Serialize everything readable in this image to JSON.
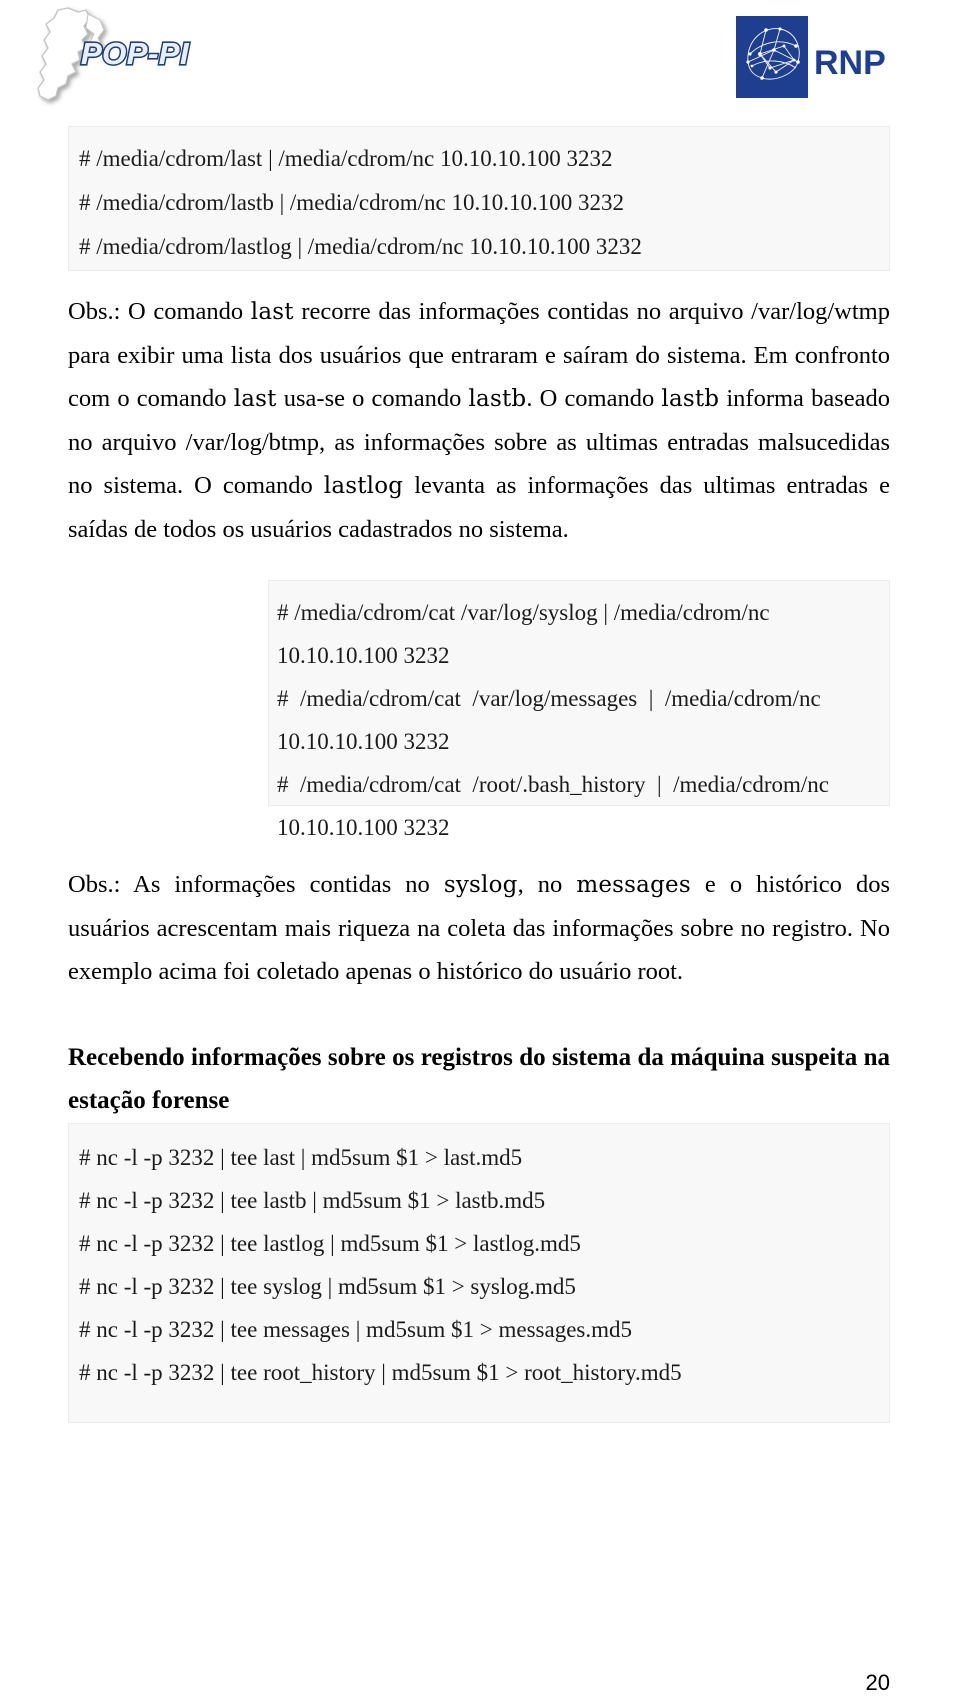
{
  "header": {
    "left_logo": {
      "name": "POP-PI",
      "text": "POP-PI",
      "text_color": "#1f3f7a",
      "map_fill": "#ffffff",
      "map_stroke": "#b9b9b9"
    },
    "right_logo": {
      "name": "RNP",
      "text": "RNP",
      "text_color": "#1c3f94",
      "box_color": "#1e3f8f",
      "network_color": "#ffffff"
    }
  },
  "code_block_1": {
    "lines": [
      "# /media/cdrom/last | /media/cdrom/nc 10.10.10.100 3232",
      "# /media/cdrom/lastb | /media/cdrom/nc 10.10.10.100 3232",
      "# /media/cdrom/lastlog | /media/cdrom/nc 10.10.10.100 3232"
    ]
  },
  "paragraph_1": {
    "prefix": "Obs.:",
    "segments": [
      {
        "t": " O comando ",
        "style": "normal"
      },
      {
        "t": "last",
        "style": "mono"
      },
      {
        "t": " recorre das informações contidas no arquivo /var/log/wtmp para exibir uma lista dos usuários que entraram e saíram do sistema. Em confronto com o comando ",
        "style": "normal"
      },
      {
        "t": "last",
        "style": "mono"
      },
      {
        "t": " usa-se o comando ",
        "style": "normal"
      },
      {
        "t": "lastb",
        "style": "mono"
      },
      {
        "t": ". O comando ",
        "style": "normal"
      },
      {
        "t": "lastb",
        "style": "mono"
      },
      {
        "t": " informa baseado no arquivo /var/log/btmp, as informações sobre as ultimas entradas malsucedidas no sistema. O comando ",
        "style": "normal"
      },
      {
        "t": "lastlog",
        "style": "mono"
      },
      {
        "t": " levanta as informações das ultimas entradas e saídas de todos os usuários cadastrados no sistema.",
        "style": "normal"
      }
    ],
    "full_text": "Obs.: O comando last recorre das informações contidas no arquivo /var/log/wtmp para exibir uma lista dos usuários que entraram e saíram do sistema. Em confronto com o comando last usa-se o comando lastb. O comando lastb informa baseado no arquivo /var/log/btmp, as informações sobre as ultimas entradas malsucedidas no sistema. O comando lastlog levanta as informações das ultimas entradas e saídas de todos os usuários cadastrados no sistema."
  },
  "code_block_2": {
    "lines": [
      "# /media/cdrom/cat /var/log/syslog | /media/cdrom/nc 10.10.10.100 3232",
      "#  /media/cdrom/cat  /var/log/messages  |  /media/cdrom/nc  10.10.10.100 3232",
      "#  /media/cdrom/cat  /root/.bash_history  |  /media/cdrom/nc  10.10.10.100 3232"
    ]
  },
  "paragraph_2": {
    "prefix": "Obs.:",
    "segments": [
      {
        "t": " As informações contidas no ",
        "style": "normal"
      },
      {
        "t": "syslog",
        "style": "mono"
      },
      {
        "t": ", no ",
        "style": "normal"
      },
      {
        "t": "messages",
        "style": "mono"
      },
      {
        "t": " e o histórico dos usuários acrescentam mais riqueza na coleta das informações sobre no registro. No exemplo acima foi coletado apenas o histórico do usuário root.",
        "style": "normal"
      }
    ],
    "full_text": "Obs.: As informações contidas no syslog, no messages e o histórico dos usuários acrescentam mais riqueza na coleta das informações sobre no registro. No exemplo acima foi coletado apenas o histórico do usuário root."
  },
  "section_heading": {
    "text": "Recebendo informações sobre os registros do sistema da máquina suspeita na estação forense"
  },
  "code_block_3": {
    "lines": [
      "# nc -l -p 3232 | tee last | md5sum $1 > last.md5",
      "# nc -l -p 3232 | tee lastb | md5sum $1 > lastb.md5",
      "# nc -l -p 3232 | tee lastlog | md5sum $1 > lastlog.md5",
      "# nc -l -p 3232 | tee syslog | md5sum $1 > syslog.md5",
      "# nc -l -p 3232 | tee messages | md5sum $1 > messages.md5",
      "# nc -l -p 3232 | tee root_history | md5sum $1 > root_history.md5"
    ]
  },
  "footer": {
    "page_number": "20"
  }
}
